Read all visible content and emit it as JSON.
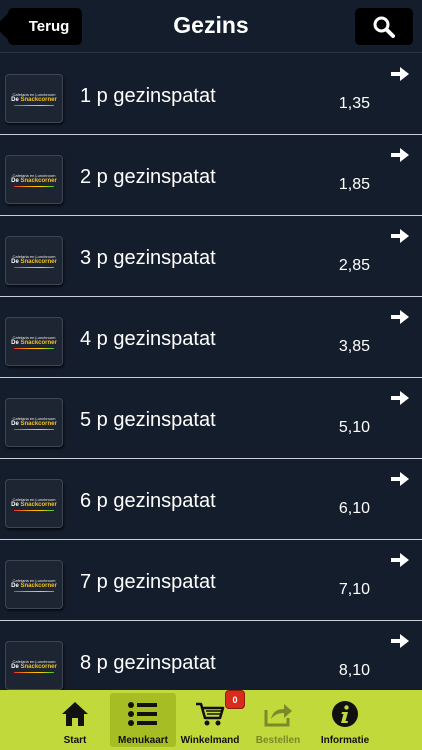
{
  "header": {
    "back_label": "Terug",
    "title": "Gezins",
    "search_icon": "search-icon"
  },
  "thumb": {
    "tagline": "Cafetaria en Lunchroom",
    "brand_prefix": "De ",
    "brand_name": "Snackcorner"
  },
  "items": [
    {
      "name": "1 p gezinspatat",
      "price": "1,35"
    },
    {
      "name": "2 p gezinspatat",
      "price": "1,85"
    },
    {
      "name": "3 p gezinspatat",
      "price": "2,85"
    },
    {
      "name": "4 p gezinspatat",
      "price": "3,85"
    },
    {
      "name": "5 p gezinspatat",
      "price": "5,10"
    },
    {
      "name": "6 p gezinspatat",
      "price": "6,10"
    },
    {
      "name": "7 p gezinspatat",
      "price": "7,10"
    },
    {
      "name": "8 p gezinspatat",
      "price": "8,10"
    }
  ],
  "tabbar": {
    "tabs": [
      {
        "label": "Start",
        "icon": "home-icon"
      },
      {
        "label": "Menukaart",
        "icon": "list-icon"
      },
      {
        "label": "Winkelmand",
        "icon": "cart-icon"
      },
      {
        "label": "Bestellen",
        "icon": "share-icon"
      },
      {
        "label": "Informatie",
        "icon": "info-icon"
      }
    ],
    "active_tab": "Menukaart",
    "cart_count": "0"
  },
  "colors": {
    "background": "#141d2b",
    "tabbar": "#c1d93a",
    "badge": "#d92b1b"
  }
}
